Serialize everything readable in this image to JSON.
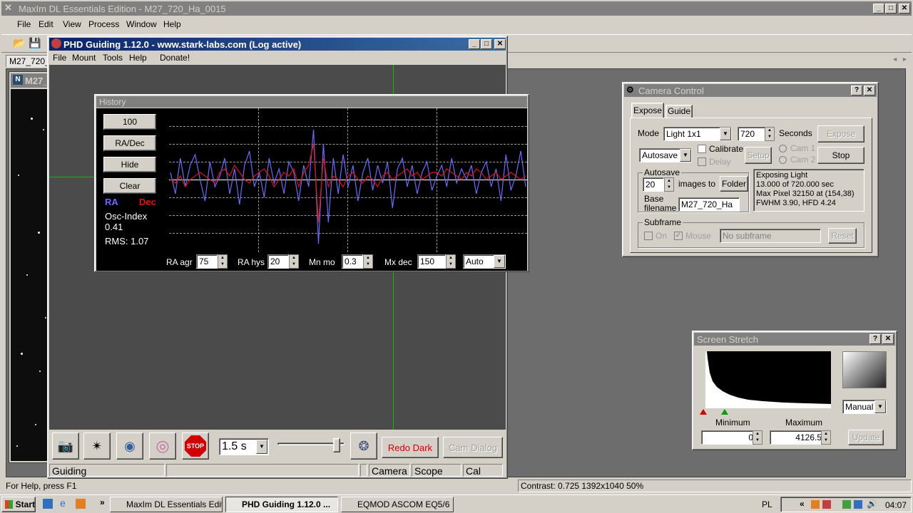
{
  "maxim": {
    "title": "MaxIm DL Essentials Edition - M27_720_Ha_0015",
    "menu": [
      "File",
      "Edit",
      "View",
      "Process",
      "Window",
      "Help"
    ],
    "doc_tab": "M27_720_",
    "doc_window_title": "M27_",
    "status_help": "For Help, press F1",
    "status_info": "Contrast: 0.725  1392x1040  50%"
  },
  "phd": {
    "title": "PHD Guiding 1.12.0  -  www.stark-labs.com (Log active)",
    "menu": [
      "File",
      "Mount",
      "Tools",
      "Help",
      "Donate!"
    ],
    "exposure": "1.5 s",
    "redo_dark": "Redo Dark",
    "cam_dialog": "Cam Dialog",
    "status": [
      "Guiding",
      "",
      "",
      "Camera",
      "Scope",
      "Cal"
    ],
    "stop_label": "STOP"
  },
  "history": {
    "title": "History",
    "btn_scale": "100",
    "btn_radec": "RA/Dec",
    "btn_hide": "Hide",
    "btn_clear": "Clear",
    "legend_ra": "RA",
    "legend_dec": "Dec",
    "osc_label": "Osc-Index",
    "osc_value": "0.41",
    "rms": "RMS: 1.07",
    "ra_agr_label": "RA agr",
    "ra_agr": "75",
    "ra_hys_label": "RA hys",
    "ra_hys": "20",
    "mn_mo_label": "Mn mo",
    "mn_mo": "0.3",
    "mx_dec_label": "Mx dec",
    "mx_dec": "150",
    "dec_mode": "Auto",
    "colors": {
      "ra": "#6a6aff",
      "dec": "#e01010"
    }
  },
  "camera": {
    "title": "Camera Control",
    "tabs": [
      "Expose",
      "Guide"
    ],
    "mode_label": "Mode",
    "mode": "Light 1x1",
    "seconds_value": "720",
    "seconds_label": "Seconds",
    "expose_btn": "Expose",
    "autosave_select": "Autosave",
    "calibrate": "Calibrate",
    "delay": "Delay",
    "setup_btn": "Setup",
    "cam1": "Cam 1",
    "cam2": "Cam 2",
    "stop_btn": "Stop",
    "autosave_group": "Autosave",
    "autosave_count": "20",
    "images_to": "images to",
    "folder_btn": "Folder",
    "base_label_1": "Base",
    "base_label_2": "filename",
    "base_filename": "M27_720_Ha",
    "info_lines": [
      "Exposing Light",
      "13.000 of 720.000 sec",
      "Max Pixel 32150 at (154,38)",
      "FWHM 3.90, HFD 4.24"
    ],
    "subframe_group": "Subframe",
    "on_label": "On",
    "mouse_label": "Mouse",
    "no_subframe": "No subframe",
    "reset_btn": "Reset"
  },
  "stretch": {
    "title": "Screen Stretch",
    "mode": "Manual",
    "min_label": "Minimum",
    "max_label": "Maximum",
    "min_value": "0",
    "max_value": "4126.5",
    "update_btn": "Update"
  },
  "taskbar": {
    "start": "Start",
    "tasks": [
      "MaxIm DL Essentials Editi...",
      "PHD Guiding 1.12.0 ...",
      "EQMOD ASCOM EQ5/6"
    ],
    "lang": "PL",
    "clock": "04:07"
  },
  "chart_data": {
    "type": "line",
    "title": "History",
    "ylim": [
      -1,
      1
    ],
    "grid": true,
    "series": [
      {
        "name": "RA",
        "color": "#6a6aff",
        "values": [
          0.1,
          -0.2,
          0.3,
          -0.1,
          0.2,
          0.35,
          0.0,
          -0.3,
          0.25,
          -0.1,
          0.05,
          0.3,
          -0.2,
          0.15,
          -0.35,
          0.2,
          0.4,
          -0.1,
          0.1,
          -0.25,
          0.3,
          -0.05,
          0.15,
          -0.2,
          0.25,
          0.1,
          -0.3,
          0.2,
          -0.1,
          0.7,
          -0.9,
          0.5,
          -0.6,
          0.3,
          -0.2,
          0.35,
          -0.1,
          0.2,
          -0.3,
          0.1,
          0.3,
          -0.15,
          0.2,
          -0.05,
          0.25,
          -0.4,
          0.15,
          0.3,
          -0.1,
          0.2,
          -0.2,
          0.1,
          0.25,
          -0.15,
          0.05,
          0.2,
          -0.1,
          0.3,
          -0.05,
          0.15,
          0.0,
          0.2,
          -0.2,
          0.1,
          0.25,
          -0.1,
          0.15,
          -0.3,
          0.35,
          -0.15,
          0.05,
          0.4,
          -0.1
        ]
      },
      {
        "name": "Dec",
        "color": "#e01010",
        "values": [
          0.0,
          -0.05,
          0.05,
          -0.1,
          0.0,
          0.05,
          0.1,
          0.05,
          0.0,
          -0.05,
          0.1,
          0.15,
          0.05,
          0.2,
          0.1,
          0.0,
          -0.05,
          0.05,
          0.1,
          0.15,
          0.05,
          -0.1,
          0.0,
          0.1,
          0.05,
          0.15,
          -0.1,
          0.1,
          0.2,
          0.5,
          -0.6,
          0.3,
          -0.1,
          0.05,
          0.0,
          -0.1,
          0.05,
          0.1,
          0.0,
          -0.05,
          0.05,
          0.0,
          -0.1,
          0.05,
          0.1,
          0.0,
          0.05,
          0.1,
          0.15,
          0.05,
          0.1,
          0.0,
          0.05,
          0.1,
          0.1,
          0.05,
          0.15,
          0.1,
          0.05,
          0.0,
          0.1,
          0.05,
          0.15,
          0.1,
          0.0,
          0.05,
          0.1,
          0.0,
          0.05,
          0.1,
          0.05,
          0.0,
          0.05
        ]
      }
    ]
  }
}
